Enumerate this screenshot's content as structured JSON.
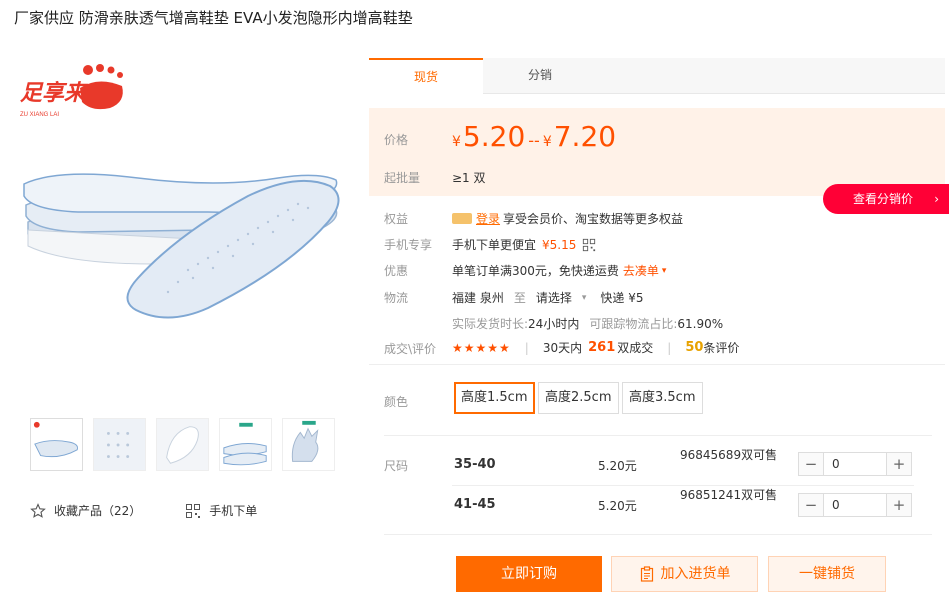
{
  "title": "厂家供应 防滑亲肤透气增高鞋垫 EVA小发泡隐形内增高鞋垫",
  "logo": {
    "main": "足享来",
    "sub": "ZU XIANG LAI"
  },
  "tabs": [
    {
      "label": "现货",
      "active": true
    },
    {
      "label": "分销",
      "active": false
    }
  ],
  "price": {
    "label": "价格",
    "currency": "¥",
    "low": "5.20",
    "separator": "--",
    "high": "7.20",
    "moq_label": "起批量",
    "moq_value": "≥1 双"
  },
  "distribution_button": {
    "label": "查看分销价",
    "arrow": "›"
  },
  "benefits": {
    "label": "权益",
    "login": "登录",
    "text": "享受会员价、淘宝数据等更多权益"
  },
  "mobile": {
    "label": "手机专享",
    "text": "手机下单更便宜",
    "price": "¥5.15"
  },
  "promo": {
    "label": "优惠",
    "text": "单笔订单满300元，免快递运费",
    "link": "去凑单"
  },
  "logistics": {
    "label": "物流",
    "from": "福建 泉州",
    "to_word": "至",
    "select": "请选择",
    "express": "快递 ¥5",
    "ship_time_label": "实际发货时长:",
    "ship_time_value": "24小时内",
    "trace_label": "可跟踪物流占比:",
    "trace_value": "61.90%"
  },
  "trade": {
    "label": "成交\\评价",
    "stars": "★★★★★",
    "days_text": "30天内",
    "sold_count": "261",
    "sold_unit": "双成交",
    "review_count": "50",
    "review_unit": "条评价"
  },
  "color": {
    "label": "颜色",
    "options": [
      {
        "label": "高度1.5cm",
        "selected": true
      },
      {
        "label": "高度2.5cm",
        "selected": false
      },
      {
        "label": "高度3.5cm",
        "selected": false
      }
    ]
  },
  "size": {
    "label": "尺码",
    "rows": [
      {
        "name": "35-40",
        "price": "5.20元",
        "stock": "96845689双可售",
        "qty": "0"
      },
      {
        "name": "41-45",
        "price": "5.20元",
        "stock": "96851241双可售",
        "qty": "0"
      }
    ],
    "minus": "−",
    "plus": "+"
  },
  "left_actions": {
    "favorite": "收藏产品（22）",
    "mobile_order": "手机下单"
  },
  "buttons": {
    "order": "立即订购",
    "cart": "加入进货单",
    "one_click": "一键铺货"
  },
  "colors": {
    "accent": "#ff6a00",
    "price": "#ff5000",
    "distribution": "#ff0036",
    "price_bg": "#fff2e8"
  }
}
